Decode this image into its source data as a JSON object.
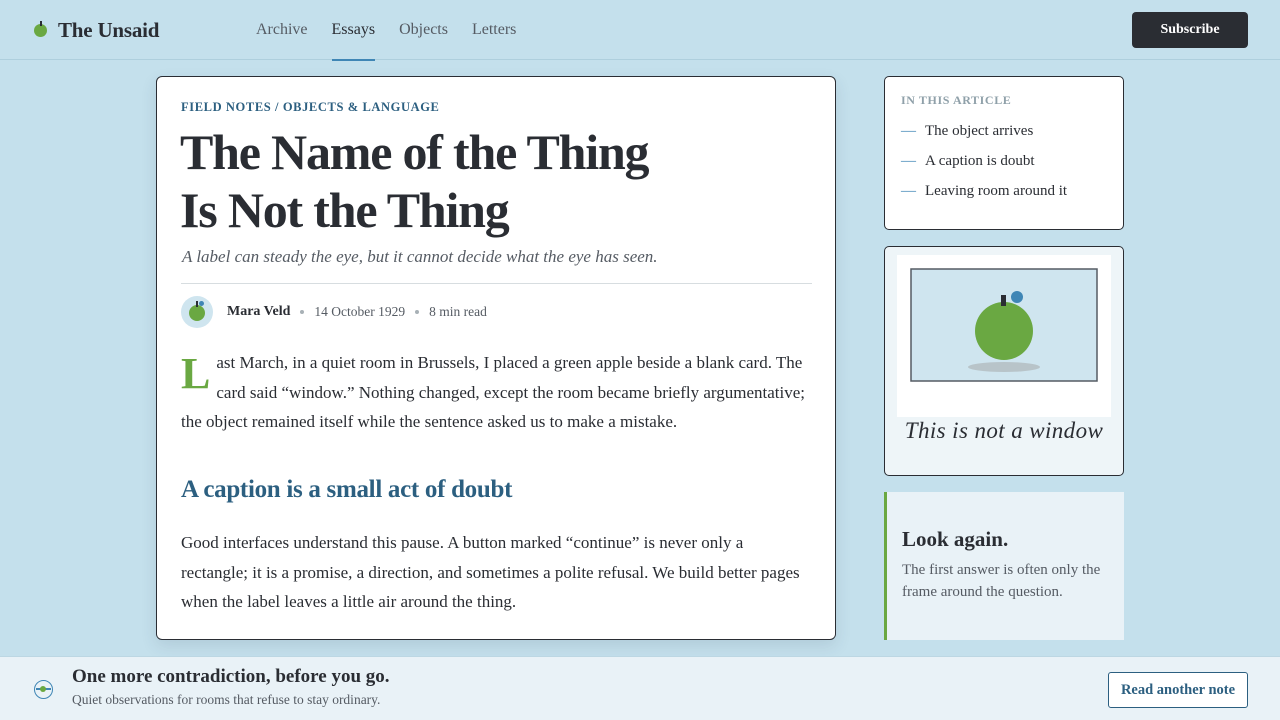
{
  "header": {
    "brand": "The Unsaid",
    "nav": [
      {
        "label": "Archive"
      },
      {
        "label": "Essays",
        "active": true
      },
      {
        "label": "Objects"
      },
      {
        "label": "Letters"
      }
    ],
    "subscribe_label": "Subscribe"
  },
  "article": {
    "kicker": "FIELD NOTES / OBJECTS & LANGUAGE",
    "headline_line1": "The Name of the Thing",
    "headline_line2": "Is Not the Thing",
    "dek": "A label can steady the eye, but it cannot decide what the eye has seen.",
    "author": "Mara Veld",
    "date": "14 October 1929",
    "read_time": "8 min read",
    "p1_dropcap": "L",
    "p1_rest": "ast March, in a quiet room in Brussels, I placed a green apple beside a blank card. The card said “window.” Nothing changed, except the room became briefly argumentative; the object remained itself while the sentence asked us to make a mistake.",
    "subhead": "A caption is a small act of doubt",
    "p2": "Good interfaces understand this pause. A button marked “continue” is never only a rectangle; it is a promise, a direction, and sometimes a polite refusal. We build better pages when the label leaves a little air around the thing."
  },
  "toc": {
    "label": "IN THIS ARTICLE",
    "items": [
      {
        "label": "The object arrives"
      },
      {
        "label": "A caption is doubt"
      },
      {
        "label": "Leaving room around it"
      }
    ]
  },
  "figure": {
    "caption": "This is not a window"
  },
  "callout": {
    "title": "Look again.",
    "text": "The first answer is often only the frame around the question."
  },
  "banner": {
    "title": "One more contradiction, before you go.",
    "subtitle": "Quiet observations for rooms that refuse to stay ordinary.",
    "button_label": "Read another note"
  },
  "colors": {
    "background": "#c4e0ec",
    "ink": "#2a2d33",
    "accent_blue": "#2c5f80",
    "link_blue": "#3f86b5",
    "apple_green": "#6aa842"
  }
}
